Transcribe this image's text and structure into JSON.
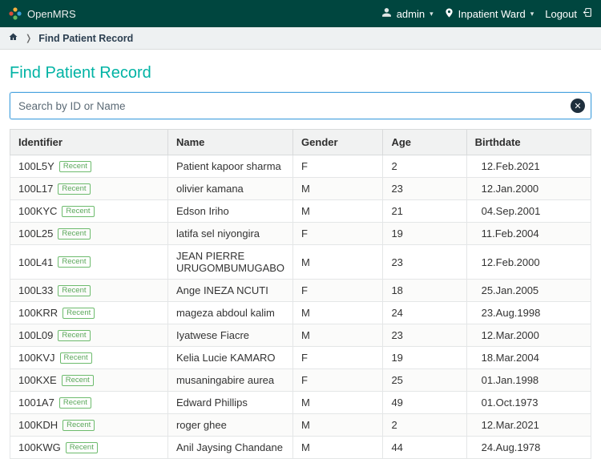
{
  "header": {
    "brand": "OpenMRS",
    "user": "admin",
    "location": "Inpatient Ward",
    "logout": "Logout"
  },
  "breadcrumb": {
    "current": "Find Patient Record"
  },
  "page": {
    "title": "Find Patient Record",
    "search_placeholder": "Search by ID or Name"
  },
  "table": {
    "headers": {
      "identifier": "Identifier",
      "name": "Name",
      "gender": "Gender",
      "age": "Age",
      "birthdate": "Birthdate"
    },
    "recent_label": "Recent",
    "rows": [
      {
        "id": "100L5Y",
        "name": "Patient kapoor sharma",
        "gender": "F",
        "age": "2",
        "birthdate": "12.Feb.2021"
      },
      {
        "id": "100L17",
        "name": "olivier kamana",
        "gender": "M",
        "age": "23",
        "birthdate": "12.Jan.2000"
      },
      {
        "id": "100KYC",
        "name": "Edson Iriho",
        "gender": "M",
        "age": "21",
        "birthdate": "04.Sep.2001"
      },
      {
        "id": "100L25",
        "name": "latifa sel niyongira",
        "gender": "F",
        "age": "19",
        "birthdate": "11.Feb.2004"
      },
      {
        "id": "100L41",
        "name": "JEAN PIERRE URUGOMBUMUGABO",
        "gender": "M",
        "age": "23",
        "birthdate": "12.Feb.2000"
      },
      {
        "id": "100L33",
        "name": "Ange INEZA NCUTI",
        "gender": "F",
        "age": "18",
        "birthdate": "25.Jan.2005"
      },
      {
        "id": "100KRR",
        "name": "mageza abdoul kalim",
        "gender": "M",
        "age": "24",
        "birthdate": "23.Aug.1998"
      },
      {
        "id": "100L09",
        "name": "Iyatwese Fiacre",
        "gender": "M",
        "age": "23",
        "birthdate": "12.Mar.2000"
      },
      {
        "id": "100KVJ",
        "name": "Kelia Lucie KAMARO",
        "gender": "F",
        "age": "19",
        "birthdate": "18.Mar.2004"
      },
      {
        "id": "100KXE",
        "name": "musaningabire aurea",
        "gender": "F",
        "age": "25",
        "birthdate": "01.Jan.1998"
      },
      {
        "id": "1001A7",
        "name": "Edward Phillips",
        "gender": "M",
        "age": "49",
        "birthdate": "01.Oct.1973"
      },
      {
        "id": "100KDH",
        "name": "roger ghee",
        "gender": "M",
        "age": "2",
        "birthdate": "12.Mar.2021"
      },
      {
        "id": "100KWG",
        "name": "Anil Jaysing Chandane",
        "gender": "M",
        "age": "44",
        "birthdate": "24.Aug.1978"
      }
    ]
  }
}
